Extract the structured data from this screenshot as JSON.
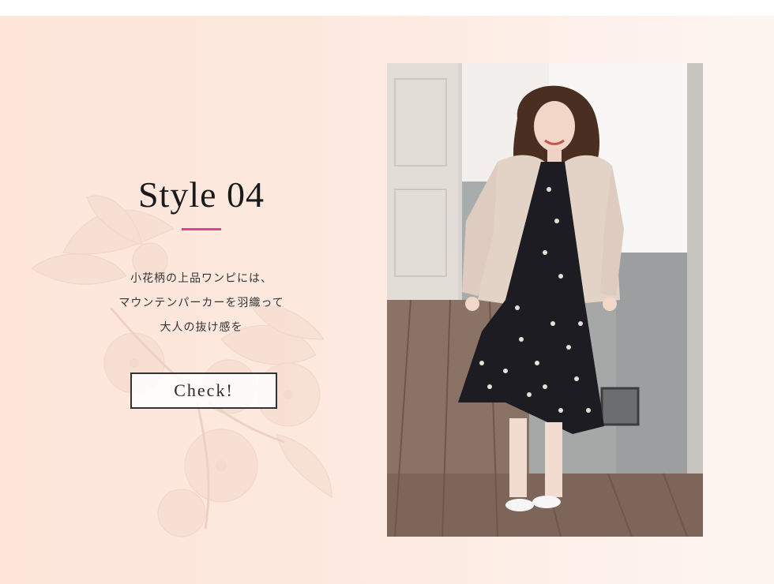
{
  "section": {
    "title": "Style 04",
    "description_lines": [
      "小花柄の上品ワンピには、",
      "マウンテンパーカーを羽織って",
      "大人の抜け感を"
    ],
    "check_label": "Check!"
  },
  "colors": {
    "accent": "#e43f9e",
    "background_left": "#fde5da",
    "background_right": "#fef5f1",
    "text": "#1a1a1a"
  },
  "photo": {
    "subject": "model-in-floral-dress-and-beige-parka"
  }
}
